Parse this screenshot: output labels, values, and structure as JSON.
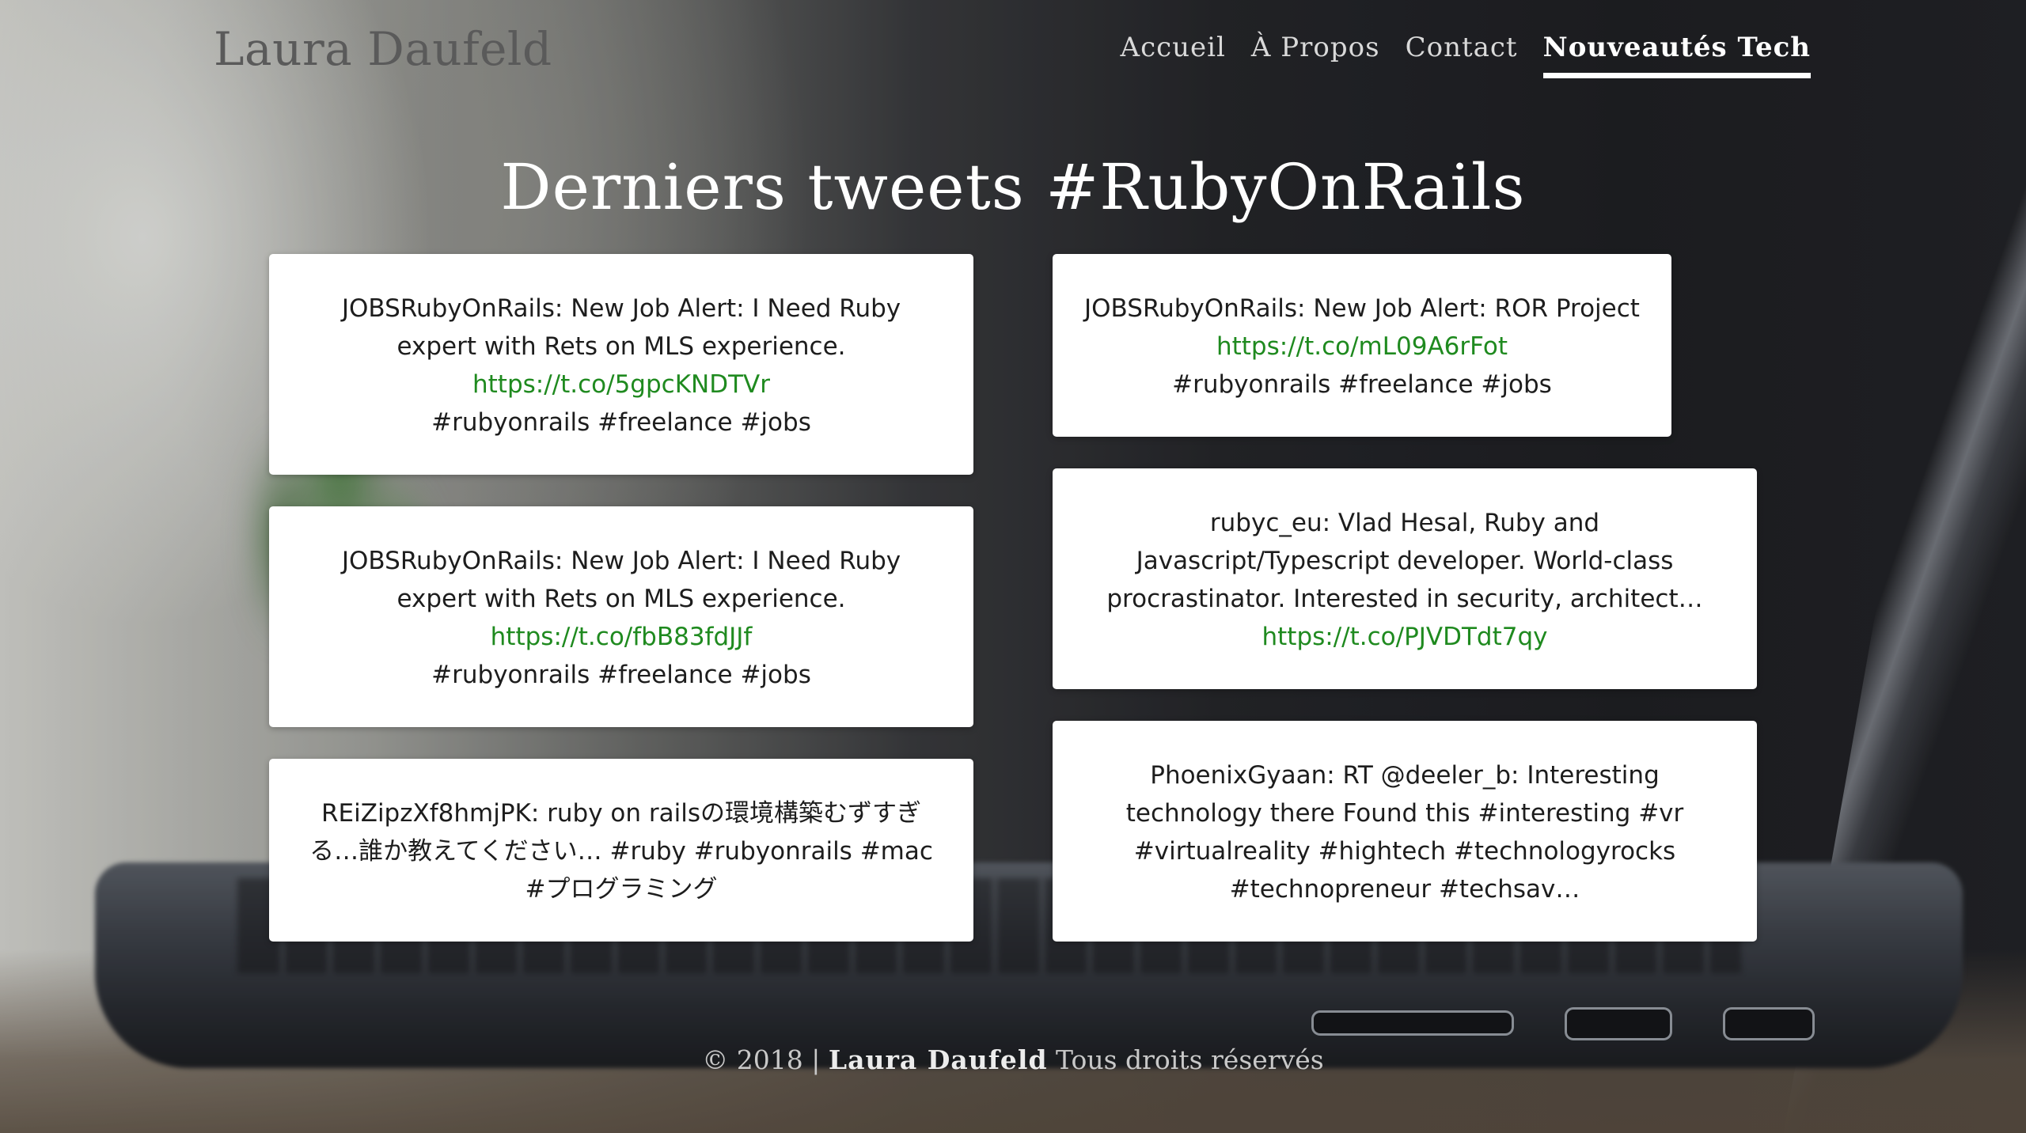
{
  "header": {
    "brand": "Laura Daufeld",
    "nav": [
      {
        "label": "Accueil",
        "active": false
      },
      {
        "label": "À Propos",
        "active": false
      },
      {
        "label": "Contact",
        "active": false
      },
      {
        "label": "Nouveautés Tech",
        "active": true
      }
    ]
  },
  "main": {
    "title": "Derniers tweets #RubyOnRails",
    "tweets": [
      {
        "text": "JOBSRubyOnRails: New Job Alert: I Need Ruby expert with Rets on MLS experience.",
        "link": "https://t.co/5gpcKNDTVr",
        "tags": "#rubyonrails #freelance #jobs"
      },
      {
        "text": "JOBSRubyOnRails: New Job Alert: ROR Project",
        "link": "https://t.co/mL09A6rFot",
        "tags": "#rubyonrails #freelance #jobs"
      },
      {
        "text": "JOBSRubyOnRails: New Job Alert: I Need Ruby expert with Rets on MLS experience.",
        "link": "https://t.co/fbB83fdJJf",
        "tags": "#rubyonrails #freelance #jobs"
      },
      {
        "text": "rubyc_eu: Vlad Hesal, Ruby and Javascript/Typescript developer. World-class procrastinator. Interested in security, architect…",
        "link": "https://t.co/PJVDTdt7qy",
        "tags": ""
      },
      {
        "text": "REiZipzXf8hmjPK: ruby on railsの環境構築むずすぎる…誰か教えてください… #ruby #rubyonrails #mac #プログラミング",
        "link": "",
        "tags": ""
      },
      {
        "text": "PhoenixGyaan: RT @deeler_b: Interesting technology there Found this #interesting #vr #virtualreality #hightech #technologyrocks #technopreneur #techsav…",
        "link": "",
        "tags": ""
      }
    ]
  },
  "footer": {
    "prefix": "© 2018 |",
    "author": "Laura Daufeld",
    "suffix": "Tous droits réservés"
  },
  "colors": {
    "link": "#1f8a1f",
    "card_bg": "#ffffff",
    "nav_active": "#ffffff"
  }
}
